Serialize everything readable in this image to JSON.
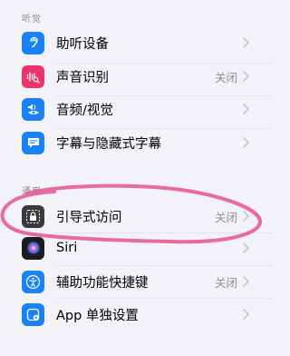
{
  "sections": [
    {
      "header": "听觉",
      "rows": [
        {
          "label": "助听设备",
          "value": "",
          "icon": "ear-icon",
          "icon_color": "#1a82f7"
        },
        {
          "label": "声音识别",
          "value": "关闭",
          "icon": "sound-recognition-icon",
          "icon_color": "#e9356a"
        },
        {
          "label": "音频/视觉",
          "value": "",
          "icon": "audio-visual-icon",
          "icon_color": "#1a82f7"
        },
        {
          "label": "字幕与隐藏式字幕",
          "value": "",
          "icon": "captions-icon",
          "icon_color": "#1a82f7"
        }
      ]
    },
    {
      "header": "通用",
      "rows": [
        {
          "label": "引导式访问",
          "value": "关闭",
          "icon": "lock-icon",
          "icon_color": "#3a3a3c"
        },
        {
          "label": "Siri",
          "value": "",
          "icon": "siri-icon",
          "icon_color": "#1c1c1e"
        },
        {
          "label": "辅助功能快捷键",
          "value": "关闭",
          "icon": "accessibility-icon",
          "icon_color": "#1a82f7"
        },
        {
          "label": "App 单独设置",
          "value": "",
          "icon": "app-settings-icon",
          "icon_color": "#1a82f7"
        }
      ]
    }
  ],
  "colors": {
    "background": "#f2f2f7",
    "annotation_stroke": "#e85a97"
  }
}
